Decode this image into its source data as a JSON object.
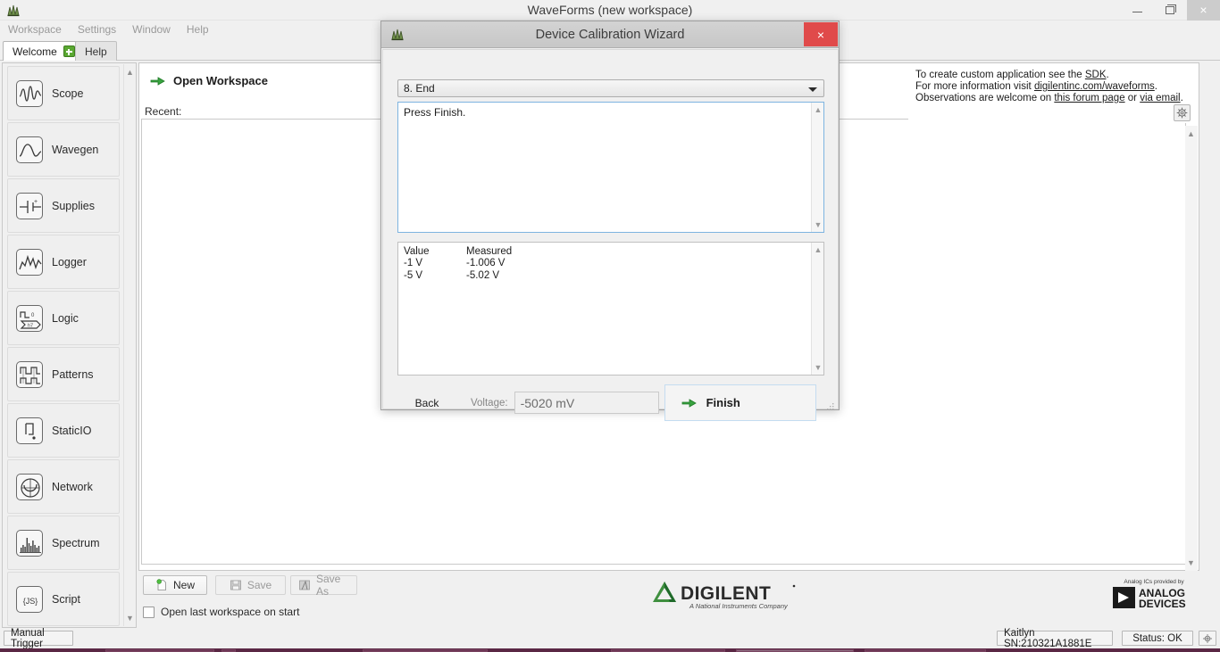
{
  "window": {
    "title": "WaveForms  (new workspace)",
    "app_icon": "waveforms-icon",
    "minimize_label": "",
    "maximize_label": "",
    "close_label": "×"
  },
  "menubar": {
    "items": [
      {
        "label": "Workspace"
      },
      {
        "label": "Settings"
      },
      {
        "label": "Window"
      },
      {
        "label": "Help"
      }
    ]
  },
  "tabs": [
    {
      "label": "Welcome",
      "active": true,
      "has_plus": true
    },
    {
      "label": "Help",
      "active": false,
      "has_plus": false
    }
  ],
  "sidebar": {
    "items": [
      {
        "label": "Scope",
        "icon": "scope-icon"
      },
      {
        "label": "Wavegen",
        "icon": "wavegen-icon"
      },
      {
        "label": "Supplies",
        "icon": "supplies-icon"
      },
      {
        "label": "Logger",
        "icon": "logger-icon"
      },
      {
        "label": "Logic",
        "icon": "logic-icon"
      },
      {
        "label": "Patterns",
        "icon": "patterns-icon"
      },
      {
        "label": "StaticIO",
        "icon": "staticio-icon"
      },
      {
        "label": "Network",
        "icon": "network-icon"
      },
      {
        "label": "Spectrum",
        "icon": "spectrum-icon"
      },
      {
        "label": "Script",
        "icon": "script-icon"
      }
    ],
    "scroll_up": "▲",
    "scroll_down": "▼"
  },
  "workspace": {
    "open_workspace_label": "Open Workspace",
    "recent_label": "Recent:"
  },
  "info_panel": {
    "line1_pre": "To create custom application see the ",
    "line1_link": "SDK",
    "line1_post": ".",
    "line2_pre": "For more information visit ",
    "line2_link": "digilentinc.com/waveforms",
    "line2_post": ".",
    "line3_pre": "Observations are welcome on ",
    "line3_link1": "this forum page",
    "line3_mid": " or ",
    "line3_link2": "via email",
    "line3_post": ".",
    "gear_icon": "gear-icon"
  },
  "toolbar": {
    "new_label": "New",
    "save_label": "Save",
    "save_as_label": "Save As",
    "open_last_label": "Open last workspace on start",
    "open_last_checked": false
  },
  "branding": {
    "digilent_name": "DIGILENT",
    "digilent_tagline": "A National Instruments Company",
    "adi_tagline": "Analog ICs provided by",
    "adi_line1": "ANALOG",
    "adi_line2": "DEVICES"
  },
  "statusbar": {
    "manual_trigger": "Manual Trigger",
    "device": "Kaitlyn SN:210321A1881E",
    "status": "Status: OK",
    "settings_icon": "gear-icon"
  },
  "dialog": {
    "title": "Device Calibration Wizard",
    "icon": "waveforms-icon",
    "close_label": "×",
    "step_select": {
      "selected": "8. End",
      "options": [
        "8. End"
      ]
    },
    "instructions": "Press Finish.",
    "results": {
      "headers": [
        "Value",
        "Measured"
      ],
      "rows": [
        {
          "value": "-1 V",
          "measured": "-1.006 V"
        },
        {
          "value": "-5 V",
          "measured": "-5.02 V"
        }
      ]
    },
    "back_label": "Back",
    "voltage_label": "Voltage:",
    "voltage_value": "-5020 mV",
    "finish_label": "Finish"
  },
  "colors": {
    "accent_green": "#2e9e37",
    "close_red": "#e04a4a",
    "dialog_title_bg": "#cdcdcd",
    "focus_blue": "#7eb4e0",
    "taskbar": "#5a2744"
  }
}
